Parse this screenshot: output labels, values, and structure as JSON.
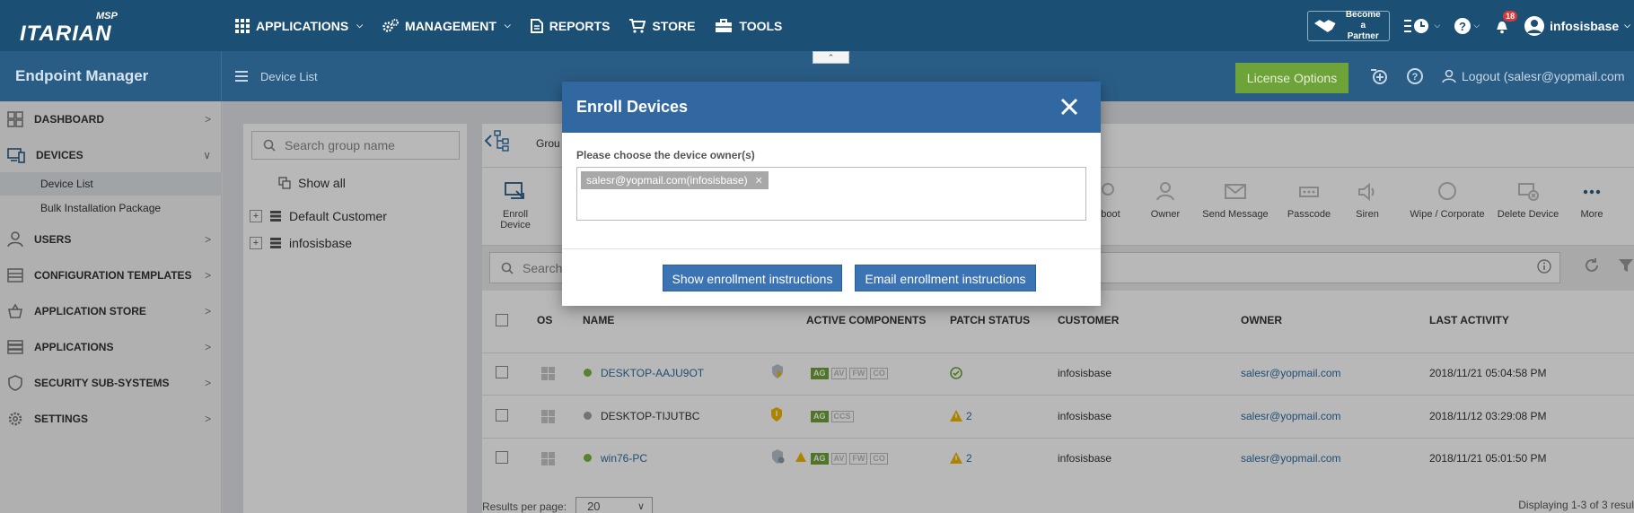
{
  "topbar": {
    "logo_msp": "MSP",
    "logo_word": "ITARIAN",
    "nav": [
      {
        "label": "APPLICATIONS",
        "has_menu": true
      },
      {
        "label": "MANAGEMENT",
        "has_menu": true
      },
      {
        "label": "REPORTS",
        "has_menu": false
      },
      {
        "label": "STORE",
        "has_menu": false
      },
      {
        "label": "TOOLS",
        "has_menu": false
      }
    ],
    "partner_line1": "Become a",
    "partner_line2": "Partner",
    "notification_count": "18",
    "username": "infosisbase"
  },
  "subbar": {
    "title": "Endpoint Manager",
    "breadcrumb": "Device List",
    "license_button": "License Options",
    "logout": "Logout (salesr@yopmail.com"
  },
  "sidebar": {
    "items": [
      {
        "label": "DASHBOARD",
        "icon": "dashboard-icon"
      },
      {
        "label": "DEVICES",
        "icon": "devices-icon"
      },
      {
        "label": "USERS",
        "icon": "users-icon"
      },
      {
        "label": "CONFIGURATION TEMPLATES",
        "icon": "templates-icon"
      },
      {
        "label": "APPLICATION STORE",
        "icon": "store-icon"
      },
      {
        "label": "APPLICATIONS",
        "icon": "applications-icon"
      },
      {
        "label": "SECURITY SUB-SYSTEMS",
        "icon": "shield-icon"
      },
      {
        "label": "SETTINGS",
        "icon": "gear-icon"
      }
    ],
    "sub_items": [
      "Device List",
      "Bulk Installation Package"
    ]
  },
  "groups": {
    "search_placeholder": "Search group name",
    "show_all": "Show all",
    "rows": [
      "Default Customer",
      "infosisbase"
    ],
    "tab_label": "Grou"
  },
  "toolbar": {
    "tools": [
      "Enroll Device",
      "boot",
      "Owner",
      "Send Message",
      "Passcode",
      "Siren",
      "Wipe / Corporate",
      "Delete Device",
      "More"
    ]
  },
  "device_search": {
    "placeholder": "Search"
  },
  "table": {
    "headers": [
      "OS",
      "NAME",
      "ACTIVE COMPONENTS",
      "PATCH STATUS",
      "CUSTOMER",
      "OWNER",
      "LAST ACTIVITY"
    ],
    "rows": [
      {
        "name": "DESKTOP-AAJU9OT",
        "status_color": "#7cb342",
        "components": [
          "AG",
          "AV",
          "FW",
          "CO"
        ],
        "components_on": 1,
        "patch": "",
        "patch_ok": true,
        "customer": "infosisbase",
        "owner": "salesr@yopmail.com",
        "last": "2018/11/21 05:04:58 PM"
      },
      {
        "name": "DESKTOP-TIJUTBC",
        "status_color": "#a0a0a0",
        "components": [
          "AG",
          "CCS"
        ],
        "components_on": 1,
        "patch": "2",
        "patch_ok": false,
        "customer": "infosisbase",
        "owner": "salesr@yopmail.com",
        "last": "2018/11/12 03:29:08 PM"
      },
      {
        "name": "win76-PC",
        "status_color": "#7cb342",
        "components": [
          "AG",
          "AV",
          "FW",
          "CO"
        ],
        "components_on": 1,
        "patch": "2",
        "patch_ok": false,
        "customer": "infosisbase",
        "owner": "salesr@yopmail.com",
        "last": "2018/11/21 05:01:50 PM"
      }
    ]
  },
  "footer": {
    "results_label": "Results per page:",
    "per_page": "20",
    "displaying": "Displaying 1-3 of 3 resul"
  },
  "modal": {
    "title": "Enroll Devices",
    "label": "Please choose the device owner(s)",
    "selected_owner": "salesr@yopmail.com(infosisbase)",
    "show_button": "Show enrollment instructions",
    "email_button": "Email enrollment instructions"
  },
  "colors": {
    "topbar": "#1c4f74",
    "subbar": "#2a5d86",
    "modal_header": "#3268a1",
    "button": "#3b73b3",
    "license": "#6ea339"
  }
}
